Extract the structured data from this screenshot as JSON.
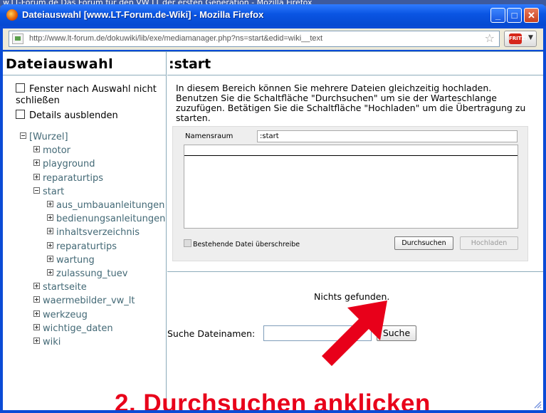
{
  "background_title": "w.LT-Forum.de Das Forum für den VW LT der ersten Generation - Mozilla Firefox",
  "window": {
    "title": "Dateiauswahl [www.LT-Forum.de-Wiki] - Mozilla Firefox",
    "minimize_label": "_",
    "maximize_label": "□",
    "close_label": "✕"
  },
  "urlbar": {
    "url": "http://www.lt-forum.de/dokuwiki/lib/exe/mediamanager.php?ns=start&edid=wiki__text",
    "addon_badge": "FRITZ!"
  },
  "left_panel": {
    "heading": "Dateiauswahl",
    "options": [
      {
        "label": "Fenster nach Auswahl nicht schließen"
      },
      {
        "label": "Details ausblenden"
      }
    ],
    "tree": [
      {
        "label": "[Wurzel]",
        "level": 0,
        "state": "minus"
      },
      {
        "label": "motor",
        "level": 1,
        "state": "plus"
      },
      {
        "label": "playground",
        "level": 1,
        "state": "plus"
      },
      {
        "label": "reparaturtips",
        "level": 1,
        "state": "plus"
      },
      {
        "label": "start",
        "level": 1,
        "state": "minus"
      },
      {
        "label": "aus_umbauanleitungen",
        "level": 2,
        "state": "plus"
      },
      {
        "label": "bedienungsanleitungen",
        "level": 2,
        "state": "plus"
      },
      {
        "label": "inhaltsverzeichnis",
        "level": 2,
        "state": "plus"
      },
      {
        "label": "reparaturtips",
        "level": 2,
        "state": "plus"
      },
      {
        "label": "wartung",
        "level": 2,
        "state": "plus"
      },
      {
        "label": "zulassung_tuev",
        "level": 2,
        "state": "plus"
      },
      {
        "label": "startseite",
        "level": 1,
        "state": "plus"
      },
      {
        "label": "waermebilder_vw_lt",
        "level": 1,
        "state": "plus"
      },
      {
        "label": "werkzeug",
        "level": 1,
        "state": "plus"
      },
      {
        "label": "wichtige_daten",
        "level": 1,
        "state": "plus"
      },
      {
        "label": "wiki",
        "level": 1,
        "state": "plus"
      }
    ]
  },
  "right_panel": {
    "heading": ":start",
    "intro": "In diesem Bereich können Sie mehrere Dateien gleichzeitig hochladen. Benutzen Sie die Schaltfläche \"Durchsuchen\" um sie der Warteschlange zuzufügen. Betätigen Sie die Schaltfläche \"Hochladen\" um die Übertragung zu starten.",
    "namespace_label": "Namensraum",
    "namespace_value": ":start",
    "overwrite_label": "Bestehende Datei überschreibe",
    "browse_label": "Durchsuchen",
    "upload_label": "Hochladen",
    "nothing_found": "Nichts gefunden.",
    "search_label": "Suche Dateinamen:",
    "search_value": "",
    "search_button": "Suche"
  },
  "annotation": {
    "text": "2.  Durchsuchen anklicken",
    "color": "#e8001a"
  }
}
